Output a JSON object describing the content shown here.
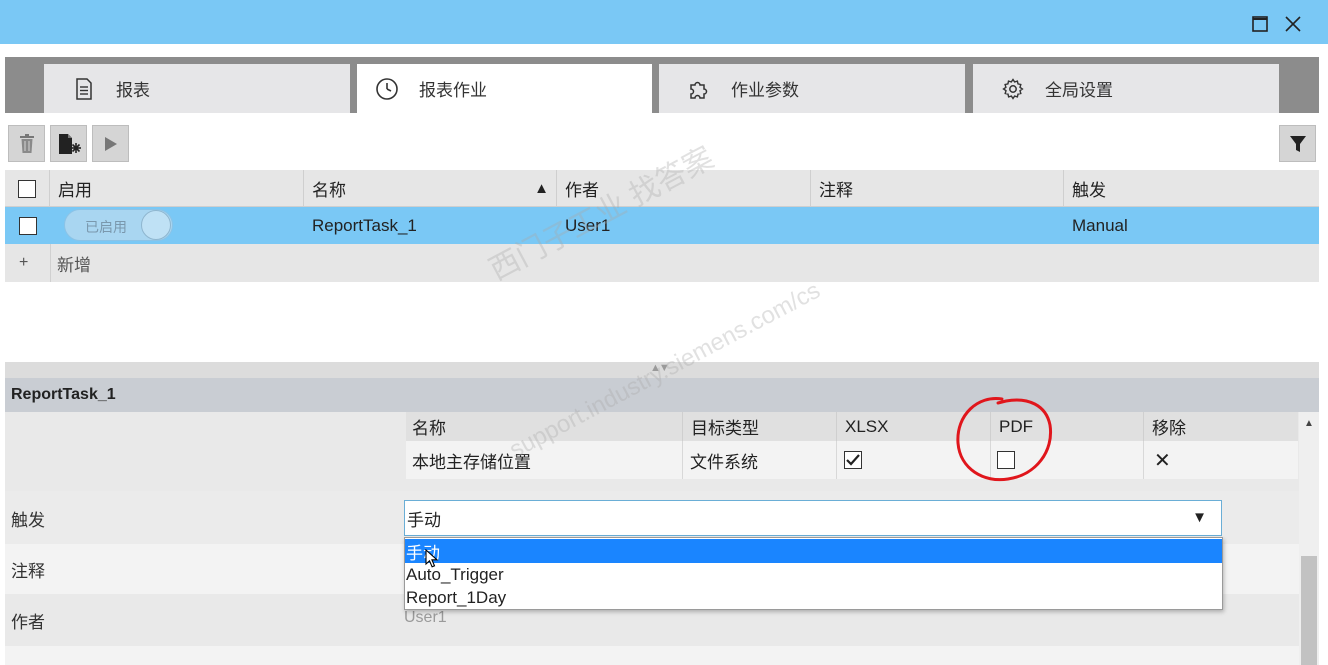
{
  "window": {
    "maximize_icon": "maximize-icon",
    "close_icon": "close-icon"
  },
  "tabs": [
    {
      "label": "报表",
      "icon": "document-icon"
    },
    {
      "label": "报表作业",
      "icon": "clock-icon"
    },
    {
      "label": "作业参数",
      "icon": "puzzle-icon"
    },
    {
      "label": "全局设置",
      "icon": "gear-icon"
    }
  ],
  "toolbar": {
    "delete_icon": "trash-icon",
    "new_icon": "new-document-icon",
    "run_icon": "play-icon",
    "filter_icon": "filter-icon"
  },
  "grid": {
    "columns": [
      "启用",
      "名称",
      "作者",
      "注释",
      "触发"
    ],
    "sort_indicator": "▲",
    "rows": [
      {
        "enabled_label": "已启用",
        "name": "ReportTask_1",
        "author": "User1",
        "comment": "",
        "trigger": "Manual"
      }
    ],
    "add_symbol": "+",
    "add_label": "新增",
    "splitter_glyph": "▲▼"
  },
  "detail": {
    "title": "ReportTask_1",
    "targets": {
      "columns": [
        "名称",
        "目标类型",
        "XLSX",
        "PDF",
        "移除"
      ],
      "rows": [
        {
          "name": "本地主存储位置",
          "type": "文件系统",
          "xlsx": true,
          "pdf": false,
          "remove": "✕"
        }
      ]
    },
    "props": {
      "trigger_label": "触发",
      "comment_label": "注释",
      "author_label": "作者",
      "author_value": "User1"
    },
    "trigger_select": {
      "value": "手动",
      "arrow": "▼",
      "options": [
        "手动",
        "Auto_Trigger",
        "Report_1Day"
      ]
    }
  },
  "watermark": {
    "line1": "西门子工业   找答案",
    "line2": "support.industry.siemens.com/cs"
  },
  "colors": {
    "titlebar": "#7ac8f5",
    "selected_row": "#7ac8f5",
    "dropdown_highlight": "#1a85ff",
    "annotation_circle": "#e0161c"
  }
}
